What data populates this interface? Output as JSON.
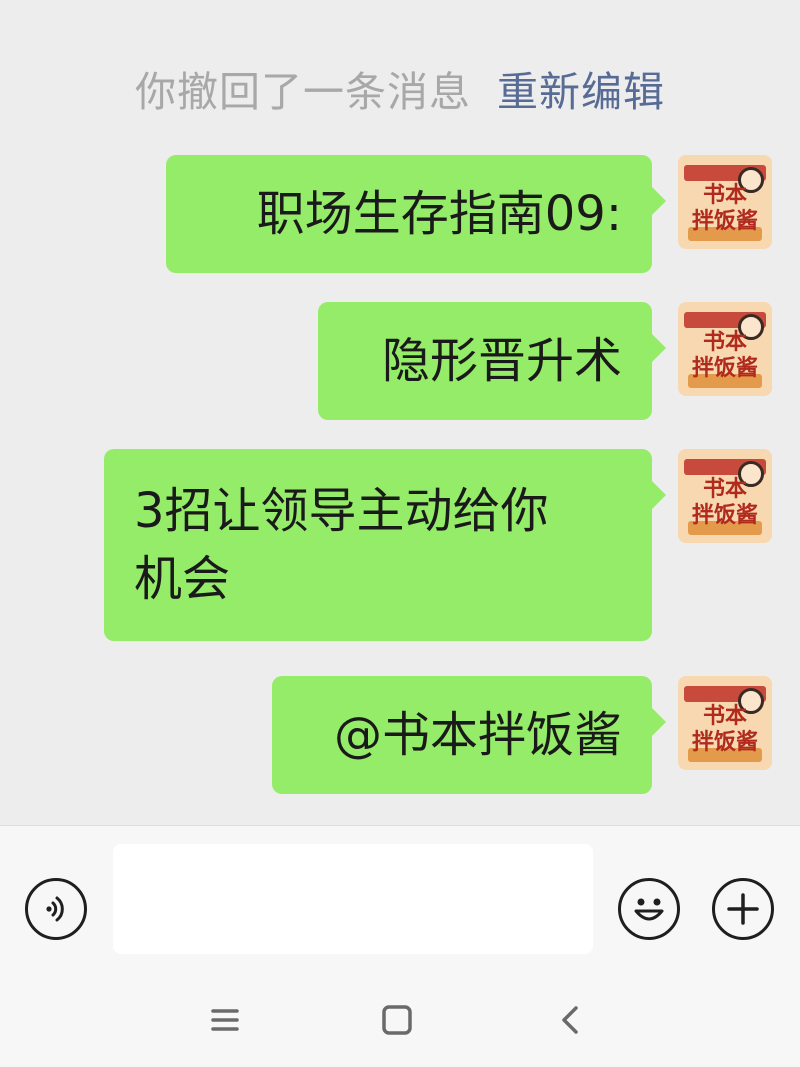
{
  "system_notice": {
    "text": "你撤回了一条消息",
    "action": "重新编辑"
  },
  "messages": [
    {
      "text": "职场生存指南09:",
      "sender": "self"
    },
    {
      "text": "隐形晋升术",
      "sender": "self"
    },
    {
      "text": "3招让领导主动给你\n机会",
      "sender": "self"
    },
    {
      "text": "@书本拌饭酱",
      "sender": "self"
    }
  ],
  "avatar": {
    "logo_line1": "书本",
    "logo_line2": "拌饭酱"
  },
  "input": {
    "value": "",
    "placeholder": ""
  },
  "icons": {
    "voice": "voice-input-icon",
    "emoji": "emoji-icon",
    "plus": "more-plus-icon",
    "nav_menu": "menu-icon",
    "nav_home": "home-square-icon",
    "nav_back": "back-chevron-icon"
  },
  "colors": {
    "background": "#ededed",
    "bubble_self": "#95ec69",
    "link": "#576b95",
    "notice_text": "#a8a8a8"
  }
}
